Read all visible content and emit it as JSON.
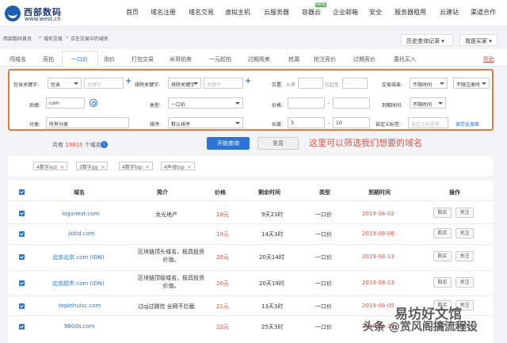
{
  "header": {
    "logo_cn": "西部数码",
    "logo_en": "www.west.cn",
    "nav": [
      "首页",
      "域名注册",
      "域名交易",
      "虚拟主机",
      "云服务器",
      "容器云",
      "企业邮箱",
      "安全",
      "服务器租用",
      "云建站",
      "渠道合作"
    ],
    "new_badge": "NEW"
  },
  "breadcrumb": {
    "items": [
      "西部数码首页",
      "域名交易",
      "正在交易中的域名"
    ],
    "separator": ">"
  },
  "toolbar": {
    "history_label": "历史查询记录",
    "role_label": "我是买家"
  },
  "tabs": {
    "items": [
      "闯域名",
      "竞拍",
      "一口价",
      "询价",
      "打包交易",
      "米哥拍卖",
      "一元起拍",
      "过期用卖",
      "抢漏",
      "抢注竞价",
      "过期竞价",
      "委托买入"
    ],
    "help": "帮助",
    "active_index": 2
  },
  "filters": {
    "include_label": "包含关键字:",
    "include_mode": "包含",
    "include_placeholder": "关键字",
    "exclude_label": "排除关键字:",
    "exclude_mode": "排除关键字",
    "exclude_placeholder": "关键字",
    "position_label": "位置:",
    "from_label": "从第",
    "start_label": "位起至",
    "end_label": "交易结束:",
    "end_value": "不限时间",
    "register_value": "不限注册时",
    "suffix_label": "后缀:",
    "suffix_value": "com",
    "type_label": "类型:",
    "type_value": "一口价",
    "price_label": "价格:",
    "price_dash": "-",
    "expire_label": "到期时间:",
    "expire_value": "不限时间",
    "category_label": "分类:",
    "category_value": "所有分类",
    "sort_label": "排序:",
    "sort_value": "默认排序",
    "length_label": "长度:",
    "length_min": "3",
    "length_dash": "-",
    "length_max": "10",
    "custom_label": "自定义标签:",
    "custom_placeholder": "自定义标签名",
    "save_label": "保存此搜索"
  },
  "summary": {
    "prefix": "共有",
    "count": "19816",
    "suffix": "个域名"
  },
  "buttons": {
    "search": "开始查询",
    "reset": "重置"
  },
  "annotation": "这里可以筛选我们想要的域名",
  "tags": [
    "4数字xyz",
    "3数字gg",
    "4数字top",
    "4声母top"
  ],
  "table": {
    "headers": [
      "域名",
      "简介",
      "价格",
      "剩余时间",
      "类型",
      "到期时间",
      "操作"
    ],
    "rows": [
      {
        "domain": "loganest.com",
        "intro": "龙光地产",
        "price": "18元",
        "remain": "9天23时",
        "type": "一口价",
        "expire": "2019-08-02"
      },
      {
        "domain": "jidiid.com",
        "intro": "",
        "price": "19元",
        "remain": "14天3时",
        "type": "一口价",
        "expire": "2019-08-06"
      },
      {
        "domain": "北京北京.com (IDN)",
        "intro": "区块链顶头域名，极具投资价值。",
        "price": "20元",
        "remain": "20天14时",
        "type": "一口价",
        "expire": "2019-08-13"
      },
      {
        "domain": "北京超市.com (IDN)",
        "intro": "区块链顶级域名，极具投资价值。",
        "price": "20元",
        "remain": "20天19时",
        "type": "一口价",
        "expire": "2019-08-13"
      },
      {
        "domain": "tepinhuisc.com",
        "intro": "过qj过微信 全网不拦截",
        "price": "21元",
        "remain": "13天3时",
        "type": "一口价",
        "expire": "2019-08-05"
      },
      {
        "domain": "960ds.com",
        "intro": "",
        "price": "22元",
        "remain": "25天3时",
        "type": "一口价",
        "expire": "2019-08-18"
      }
    ],
    "buy_label": "购买",
    "follow_label": "关注"
  },
  "watermark": {
    "line1": "易坊好文馆",
    "line2": "头条 @赏风阁搞流程设"
  }
}
